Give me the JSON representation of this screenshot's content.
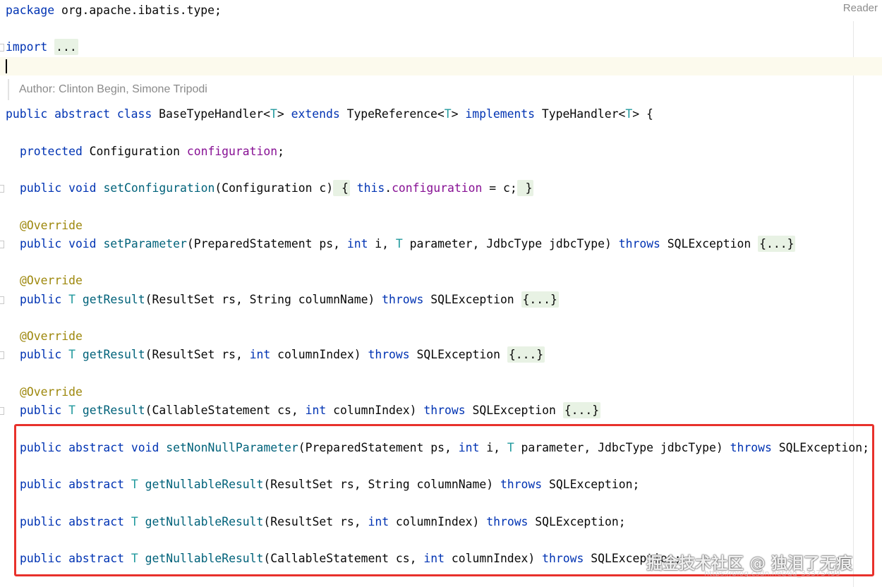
{
  "reader_label": "Reader",
  "author_hint": "Author: Clinton Begin, Simone Tripodi",
  "code": {
    "package_kw": "package",
    "package_name": " org.apache.ibatis.type;",
    "import_kw": "import",
    "import_fold": "...",
    "class_decl": {
      "mods": "public abstract class",
      "name": " BaseTypeHandler<",
      "t1": "T",
      "mid1": "> ",
      "extends": "extends",
      "sup": " TypeReference<",
      "t2": "T",
      "mid2": "> ",
      "implements": "implements",
      "iface": " TypeHandler<",
      "t3": "T",
      "end": "> {"
    },
    "field": {
      "mod": "protected",
      "type": " Configuration ",
      "name": "configuration",
      "end": ";"
    },
    "set_config": {
      "mods": "public void",
      "name": "setConfiguration",
      "params": "(Configuration c)",
      "open": " {",
      "this": " this",
      "dot": ".",
      "fld": "configuration",
      "assign": " = c;",
      "close": " }"
    },
    "override": "@Override",
    "set_param": {
      "mods": "public void",
      "name": "setParameter",
      "p1": "(PreparedStatement ps, ",
      "int": "int",
      "p2": " i, ",
      "t": "T",
      "p3": " parameter, JdbcType jdbcType) ",
      "throws": "throws",
      "exc": " SQLException ",
      "fold": "{...}"
    },
    "get_result_name": {
      "mods": "public",
      "t": "T",
      "name": "getResult",
      "p1": "(ResultSet rs, String columnName) ",
      "throws": "throws",
      "exc": " SQLException ",
      "fold": "{...}"
    },
    "get_result_index": {
      "mods": "public",
      "t": "T",
      "name": "getResult",
      "p1": "(ResultSet rs, ",
      "int": "int",
      "p2": " columnIndex) ",
      "throws": "throws",
      "exc": " SQLException ",
      "fold": "{...}"
    },
    "get_result_cs": {
      "mods": "public",
      "t": "T",
      "name": "getResult",
      "p1": "(CallableStatement cs, ",
      "int": "int",
      "p2": " columnIndex) ",
      "throws": "throws",
      "exc": " SQLException ",
      "fold": "{...}"
    },
    "abs_set_nonnull": {
      "mods": "public abstract void",
      "name": "setNonNullParameter",
      "p1": "(PreparedStatement ps, ",
      "int": "int",
      "p2": " i, ",
      "t": "T",
      "p3": " parameter, JdbcType jdbcType) ",
      "throws": "throws",
      "exc": " SQLException;"
    },
    "abs_nullable_name": {
      "mods": "public abstract",
      "t": "T",
      "name": "getNullableResult",
      "p1": "(ResultSet rs, String columnName) ",
      "throws": "throws",
      "exc": " SQLException;"
    },
    "abs_nullable_index": {
      "mods": "public abstract",
      "t": "T",
      "name": "getNullableResult",
      "p1": "(ResultSet rs, ",
      "int": "int",
      "p2": " columnIndex) ",
      "throws": "throws",
      "exc": " SQLException;"
    },
    "abs_nullable_cs": {
      "mods": "public abstract",
      "t": "T",
      "name": "getNullableResult",
      "p1": "(CallableStatement cs, ",
      "int": "int",
      "p2": " columnIndex) ",
      "throws": "throws",
      "exc": " SQLException;"
    }
  },
  "watermark": "掘金技术社区 @ 独泪了无痕",
  "watermark_url": "https://blog.csdn.net/qq_33375499",
  "colors": {
    "keyword": "#0033b3",
    "type_param": "#20999d",
    "field": "#871094",
    "method": "#00627a",
    "annotation": "#9e880d",
    "highlight_box": "#e8312b"
  }
}
